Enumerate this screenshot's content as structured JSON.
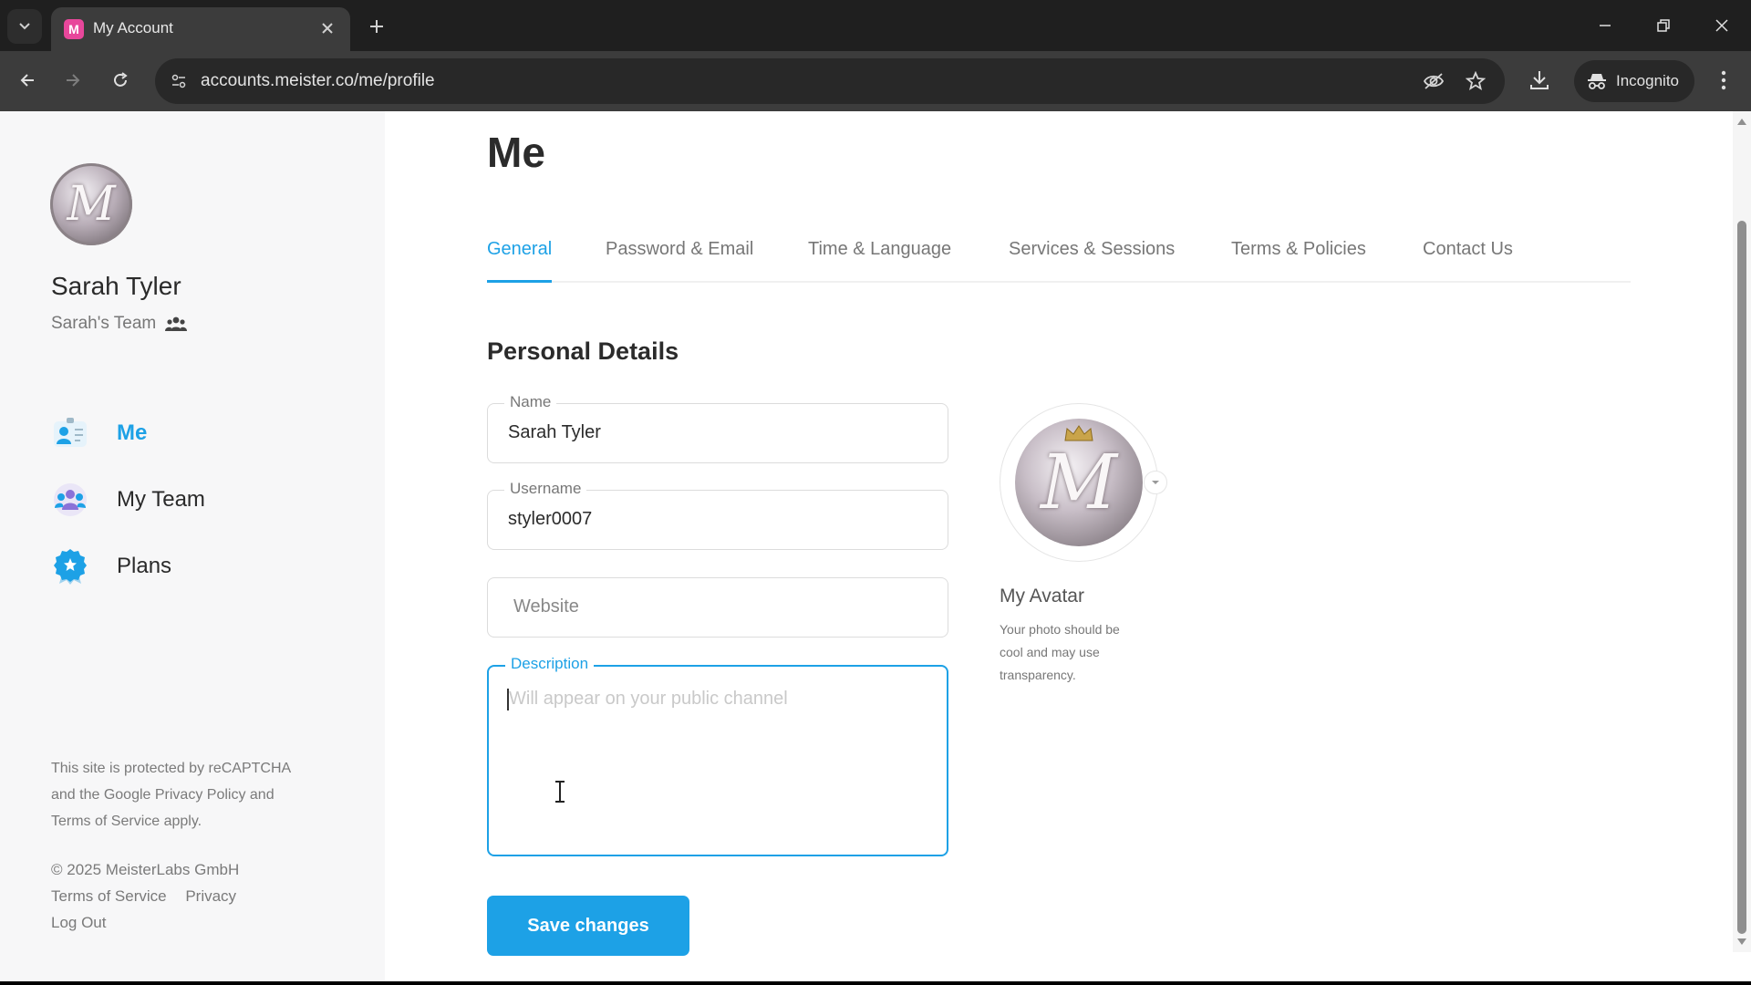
{
  "browser": {
    "tab_title": "My Account",
    "tab_favicon_letter": "M",
    "url": "accounts.meister.co/me/profile",
    "incognito_label": "Incognito",
    "colors": {
      "chrome_dark": "#1f1f1f",
      "toolbar": "#3c3c3c",
      "favicon": "#e8479b"
    }
  },
  "sidebar": {
    "avatar_letter": "M",
    "user_name": "Sarah Tyler",
    "team_name": "Sarah's Team",
    "nav": [
      {
        "label": "Me",
        "icon": "profile-card-icon",
        "active": true
      },
      {
        "label": "My Team",
        "icon": "team-icon",
        "active": false
      },
      {
        "label": "Plans",
        "icon": "badge-icon",
        "active": false
      }
    ],
    "recaptcha_line1": "This site is protected by reCAPTCHA",
    "recaptcha_line2": "and the Google Privacy Policy and",
    "recaptcha_line3": "Terms of Service apply.",
    "copyright": "© 2025 MeisterLabs GmbH",
    "terms_link": "Terms of Service",
    "privacy_link": "Privacy",
    "logout_link": "Log Out"
  },
  "main": {
    "title": "Me",
    "tabs": [
      {
        "label": "General",
        "active": true
      },
      {
        "label": "Password & Email",
        "active": false
      },
      {
        "label": "Time & Language",
        "active": false
      },
      {
        "label": "Services & Sessions",
        "active": false
      },
      {
        "label": "Terms & Policies",
        "active": false
      },
      {
        "label": "Contact Us",
        "active": false
      }
    ],
    "section_title": "Personal Details",
    "fields": {
      "name": {
        "label": "Name",
        "value": "Sarah Tyler"
      },
      "username": {
        "label": "Username",
        "value": "styler0007"
      },
      "website": {
        "placeholder": "Website",
        "value": ""
      },
      "description": {
        "label": "Description",
        "placeholder": "Will appear on your public channel",
        "value": ""
      }
    },
    "save_button": "Save changes",
    "avatar": {
      "letter": "M",
      "title": "My Avatar",
      "hint_line1": "Your photo should be",
      "hint_line2": "cool and may use",
      "hint_line3": "transparency."
    },
    "accent_color": "#1da1e6"
  }
}
